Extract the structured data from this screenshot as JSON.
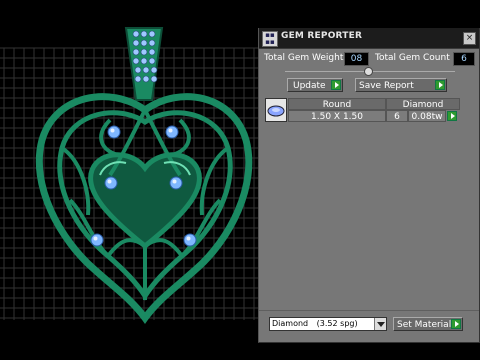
{
  "viewport": {
    "background": "#000000",
    "grid_color": "#333333",
    "metal_color": "#1a8a62",
    "gem_color": "#7fb7ff"
  },
  "panel": {
    "title": "GEM REPORTER",
    "app_icon": "gem-reporter-icon",
    "close_label": "×",
    "total_gem_weight_label": "Total Gem Weight",
    "total_gem_weight_value": "08",
    "total_gem_count_label": "Total Gem Count",
    "total_gem_count_value": "6",
    "update_label": "Update",
    "save_report_label": "Save Report",
    "table": {
      "shape_header": "Round",
      "size_value": "1.50 X 1.50",
      "material_header": "Diamond",
      "count_value": "6",
      "weight_value": "0.08tw"
    },
    "material_select_value": "Diamond",
    "material_select_spg": "(3.52 spg)",
    "set_material_label": "Set Material"
  }
}
